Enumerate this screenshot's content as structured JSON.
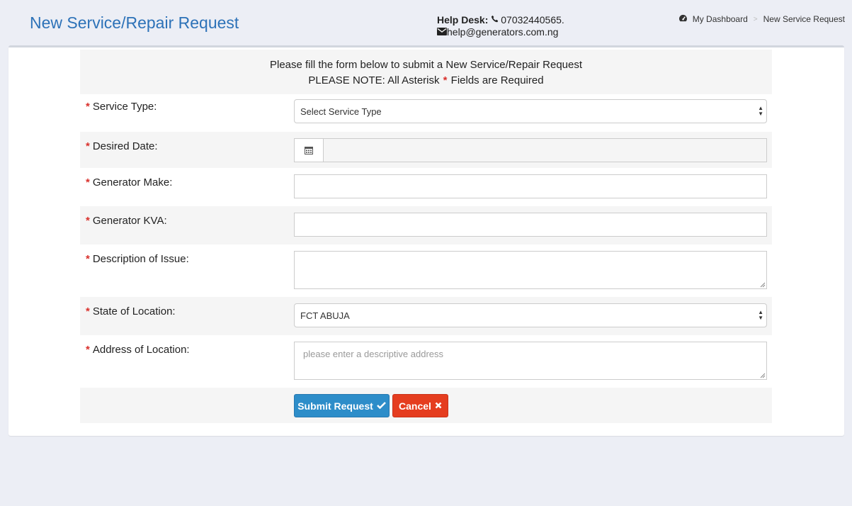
{
  "header": {
    "title": "New Service/Repair Request",
    "helpdesk_label": "Help Desk:",
    "phone": "07032440565.",
    "email": "help@generators.com.ng"
  },
  "breadcrumb": {
    "items": [
      "My Dashboard",
      "New Service Request"
    ],
    "separator": ">"
  },
  "form": {
    "intro_line1": "Please fill the form below to submit a New Service/Repair Request",
    "intro_line2_prefix": "PLEASE NOTE: All Asterisk",
    "intro_asterisk": "*",
    "intro_line2_suffix": "Fields are Required",
    "fields": {
      "service_type": {
        "label": "Service Type:",
        "value": "Select Service Type"
      },
      "desired_date": {
        "label": "Desired Date:",
        "value": ""
      },
      "generator_make": {
        "label": "Generator Make:",
        "value": ""
      },
      "generator_kva": {
        "label": "Generator KVA:",
        "value": ""
      },
      "description": {
        "label": "Description of Issue:",
        "value": ""
      },
      "state": {
        "label": "State of Location:",
        "value": "FCT ABUJA"
      },
      "address": {
        "label": "Address of Location:",
        "placeholder": "please enter a descriptive address"
      }
    },
    "required_marker": "*",
    "submit_label": "Submit Request",
    "cancel_label": "Cancel"
  },
  "colors": {
    "title": "#2d72b8",
    "required": "#d9302c",
    "submit": "#2d8dc9",
    "cancel": "#e53d1f"
  },
  "icons": {
    "phone": "phone-icon",
    "email": "envelope-icon",
    "dashboard": "dashboard-icon",
    "calendar": "calendar-icon",
    "check": "check-icon",
    "close": "close-icon"
  }
}
